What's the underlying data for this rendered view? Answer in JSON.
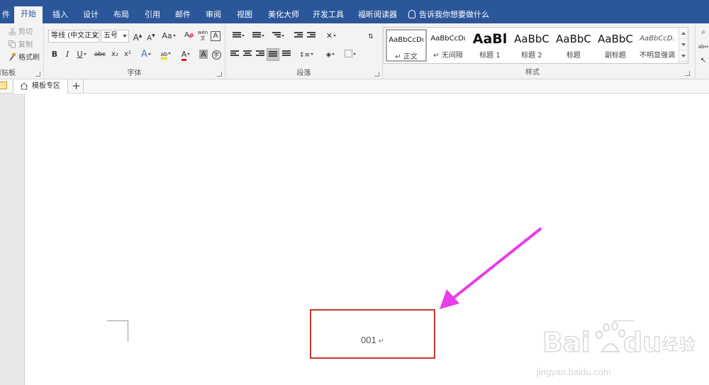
{
  "tabs": {
    "file": "件",
    "home": "开始",
    "insert": "插入",
    "design": "设计",
    "layout": "布局",
    "references": "引用",
    "mailings": "邮件",
    "review": "审阅",
    "view": "视图",
    "beautify": "美化大师",
    "developer": "开发工具",
    "foxit": "福昕阅读器"
  },
  "tell_me": "告诉我你想要做什么",
  "clipboard": {
    "cut": "剪切",
    "copy": "复制",
    "format_painter": "格式刷",
    "label": "剪贴板"
  },
  "font": {
    "name": "等线 (中文正文",
    "size": "五号",
    "grow": "A",
    "shrink": "A",
    "case": "Aa",
    "bold": "B",
    "italic": "I",
    "underline": "U",
    "strike": "abc",
    "subscript": "x₂",
    "superscript": "x²",
    "label": "字体"
  },
  "paragraph": {
    "label": "段落"
  },
  "styles": {
    "label": "样式",
    "items": [
      {
        "sample": "AaBbCcDı",
        "name": "↵ 正文"
      },
      {
        "sample": "AaBbCcDı",
        "name": "↵ 无间隔"
      },
      {
        "sample": "AaBl",
        "name": "标题 1"
      },
      {
        "sample": "AaBbC",
        "name": "标题 2"
      },
      {
        "sample": "AaBbC",
        "name": "标题"
      },
      {
        "sample": "AaBbC",
        "name": "副标题"
      },
      {
        "sample": "AaBbCcD.",
        "name": "不明显强调"
      }
    ]
  },
  "doc_tabs": {
    "template_zone": "模板专区",
    "new_tab": "+"
  },
  "document": {
    "page_number": "001",
    "paragraph_mark": "↵"
  },
  "colors": {
    "ribbon_blue": "#2b579a",
    "annotation_box": "#c0392b",
    "annotation_arrow": "#e83de8",
    "font_color_red": "#e02020",
    "highlight_yellow": "#f7e000"
  },
  "watermark": {
    "brand": "Bai du 经验",
    "url": "jingyan.baidu.com"
  }
}
